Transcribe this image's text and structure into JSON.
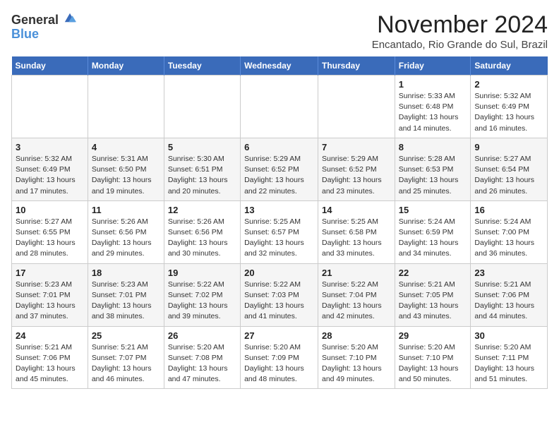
{
  "logo": {
    "line1": "General",
    "line2": "Blue"
  },
  "title": "November 2024",
  "location": "Encantado, Rio Grande do Sul, Brazil",
  "weekdays": [
    "Sunday",
    "Monday",
    "Tuesday",
    "Wednesday",
    "Thursday",
    "Friday",
    "Saturday"
  ],
  "weeks": [
    [
      {
        "day": "",
        "info": ""
      },
      {
        "day": "",
        "info": ""
      },
      {
        "day": "",
        "info": ""
      },
      {
        "day": "",
        "info": ""
      },
      {
        "day": "",
        "info": ""
      },
      {
        "day": "1",
        "info": "Sunrise: 5:33 AM\nSunset: 6:48 PM\nDaylight: 13 hours\nand 14 minutes."
      },
      {
        "day": "2",
        "info": "Sunrise: 5:32 AM\nSunset: 6:49 PM\nDaylight: 13 hours\nand 16 minutes."
      }
    ],
    [
      {
        "day": "3",
        "info": "Sunrise: 5:32 AM\nSunset: 6:49 PM\nDaylight: 13 hours\nand 17 minutes."
      },
      {
        "day": "4",
        "info": "Sunrise: 5:31 AM\nSunset: 6:50 PM\nDaylight: 13 hours\nand 19 minutes."
      },
      {
        "day": "5",
        "info": "Sunrise: 5:30 AM\nSunset: 6:51 PM\nDaylight: 13 hours\nand 20 minutes."
      },
      {
        "day": "6",
        "info": "Sunrise: 5:29 AM\nSunset: 6:52 PM\nDaylight: 13 hours\nand 22 minutes."
      },
      {
        "day": "7",
        "info": "Sunrise: 5:29 AM\nSunset: 6:52 PM\nDaylight: 13 hours\nand 23 minutes."
      },
      {
        "day": "8",
        "info": "Sunrise: 5:28 AM\nSunset: 6:53 PM\nDaylight: 13 hours\nand 25 minutes."
      },
      {
        "day": "9",
        "info": "Sunrise: 5:27 AM\nSunset: 6:54 PM\nDaylight: 13 hours\nand 26 minutes."
      }
    ],
    [
      {
        "day": "10",
        "info": "Sunrise: 5:27 AM\nSunset: 6:55 PM\nDaylight: 13 hours\nand 28 minutes."
      },
      {
        "day": "11",
        "info": "Sunrise: 5:26 AM\nSunset: 6:56 PM\nDaylight: 13 hours\nand 29 minutes."
      },
      {
        "day": "12",
        "info": "Sunrise: 5:26 AM\nSunset: 6:56 PM\nDaylight: 13 hours\nand 30 minutes."
      },
      {
        "day": "13",
        "info": "Sunrise: 5:25 AM\nSunset: 6:57 PM\nDaylight: 13 hours\nand 32 minutes."
      },
      {
        "day": "14",
        "info": "Sunrise: 5:25 AM\nSunset: 6:58 PM\nDaylight: 13 hours\nand 33 minutes."
      },
      {
        "day": "15",
        "info": "Sunrise: 5:24 AM\nSunset: 6:59 PM\nDaylight: 13 hours\nand 34 minutes."
      },
      {
        "day": "16",
        "info": "Sunrise: 5:24 AM\nSunset: 7:00 PM\nDaylight: 13 hours\nand 36 minutes."
      }
    ],
    [
      {
        "day": "17",
        "info": "Sunrise: 5:23 AM\nSunset: 7:01 PM\nDaylight: 13 hours\nand 37 minutes."
      },
      {
        "day": "18",
        "info": "Sunrise: 5:23 AM\nSunset: 7:01 PM\nDaylight: 13 hours\nand 38 minutes."
      },
      {
        "day": "19",
        "info": "Sunrise: 5:22 AM\nSunset: 7:02 PM\nDaylight: 13 hours\nand 39 minutes."
      },
      {
        "day": "20",
        "info": "Sunrise: 5:22 AM\nSunset: 7:03 PM\nDaylight: 13 hours\nand 41 minutes."
      },
      {
        "day": "21",
        "info": "Sunrise: 5:22 AM\nSunset: 7:04 PM\nDaylight: 13 hours\nand 42 minutes."
      },
      {
        "day": "22",
        "info": "Sunrise: 5:21 AM\nSunset: 7:05 PM\nDaylight: 13 hours\nand 43 minutes."
      },
      {
        "day": "23",
        "info": "Sunrise: 5:21 AM\nSunset: 7:06 PM\nDaylight: 13 hours\nand 44 minutes."
      }
    ],
    [
      {
        "day": "24",
        "info": "Sunrise: 5:21 AM\nSunset: 7:06 PM\nDaylight: 13 hours\nand 45 minutes."
      },
      {
        "day": "25",
        "info": "Sunrise: 5:21 AM\nSunset: 7:07 PM\nDaylight: 13 hours\nand 46 minutes."
      },
      {
        "day": "26",
        "info": "Sunrise: 5:20 AM\nSunset: 7:08 PM\nDaylight: 13 hours\nand 47 minutes."
      },
      {
        "day": "27",
        "info": "Sunrise: 5:20 AM\nSunset: 7:09 PM\nDaylight: 13 hours\nand 48 minutes."
      },
      {
        "day": "28",
        "info": "Sunrise: 5:20 AM\nSunset: 7:10 PM\nDaylight: 13 hours\nand 49 minutes."
      },
      {
        "day": "29",
        "info": "Sunrise: 5:20 AM\nSunset: 7:10 PM\nDaylight: 13 hours\nand 50 minutes."
      },
      {
        "day": "30",
        "info": "Sunrise: 5:20 AM\nSunset: 7:11 PM\nDaylight: 13 hours\nand 51 minutes."
      }
    ]
  ]
}
